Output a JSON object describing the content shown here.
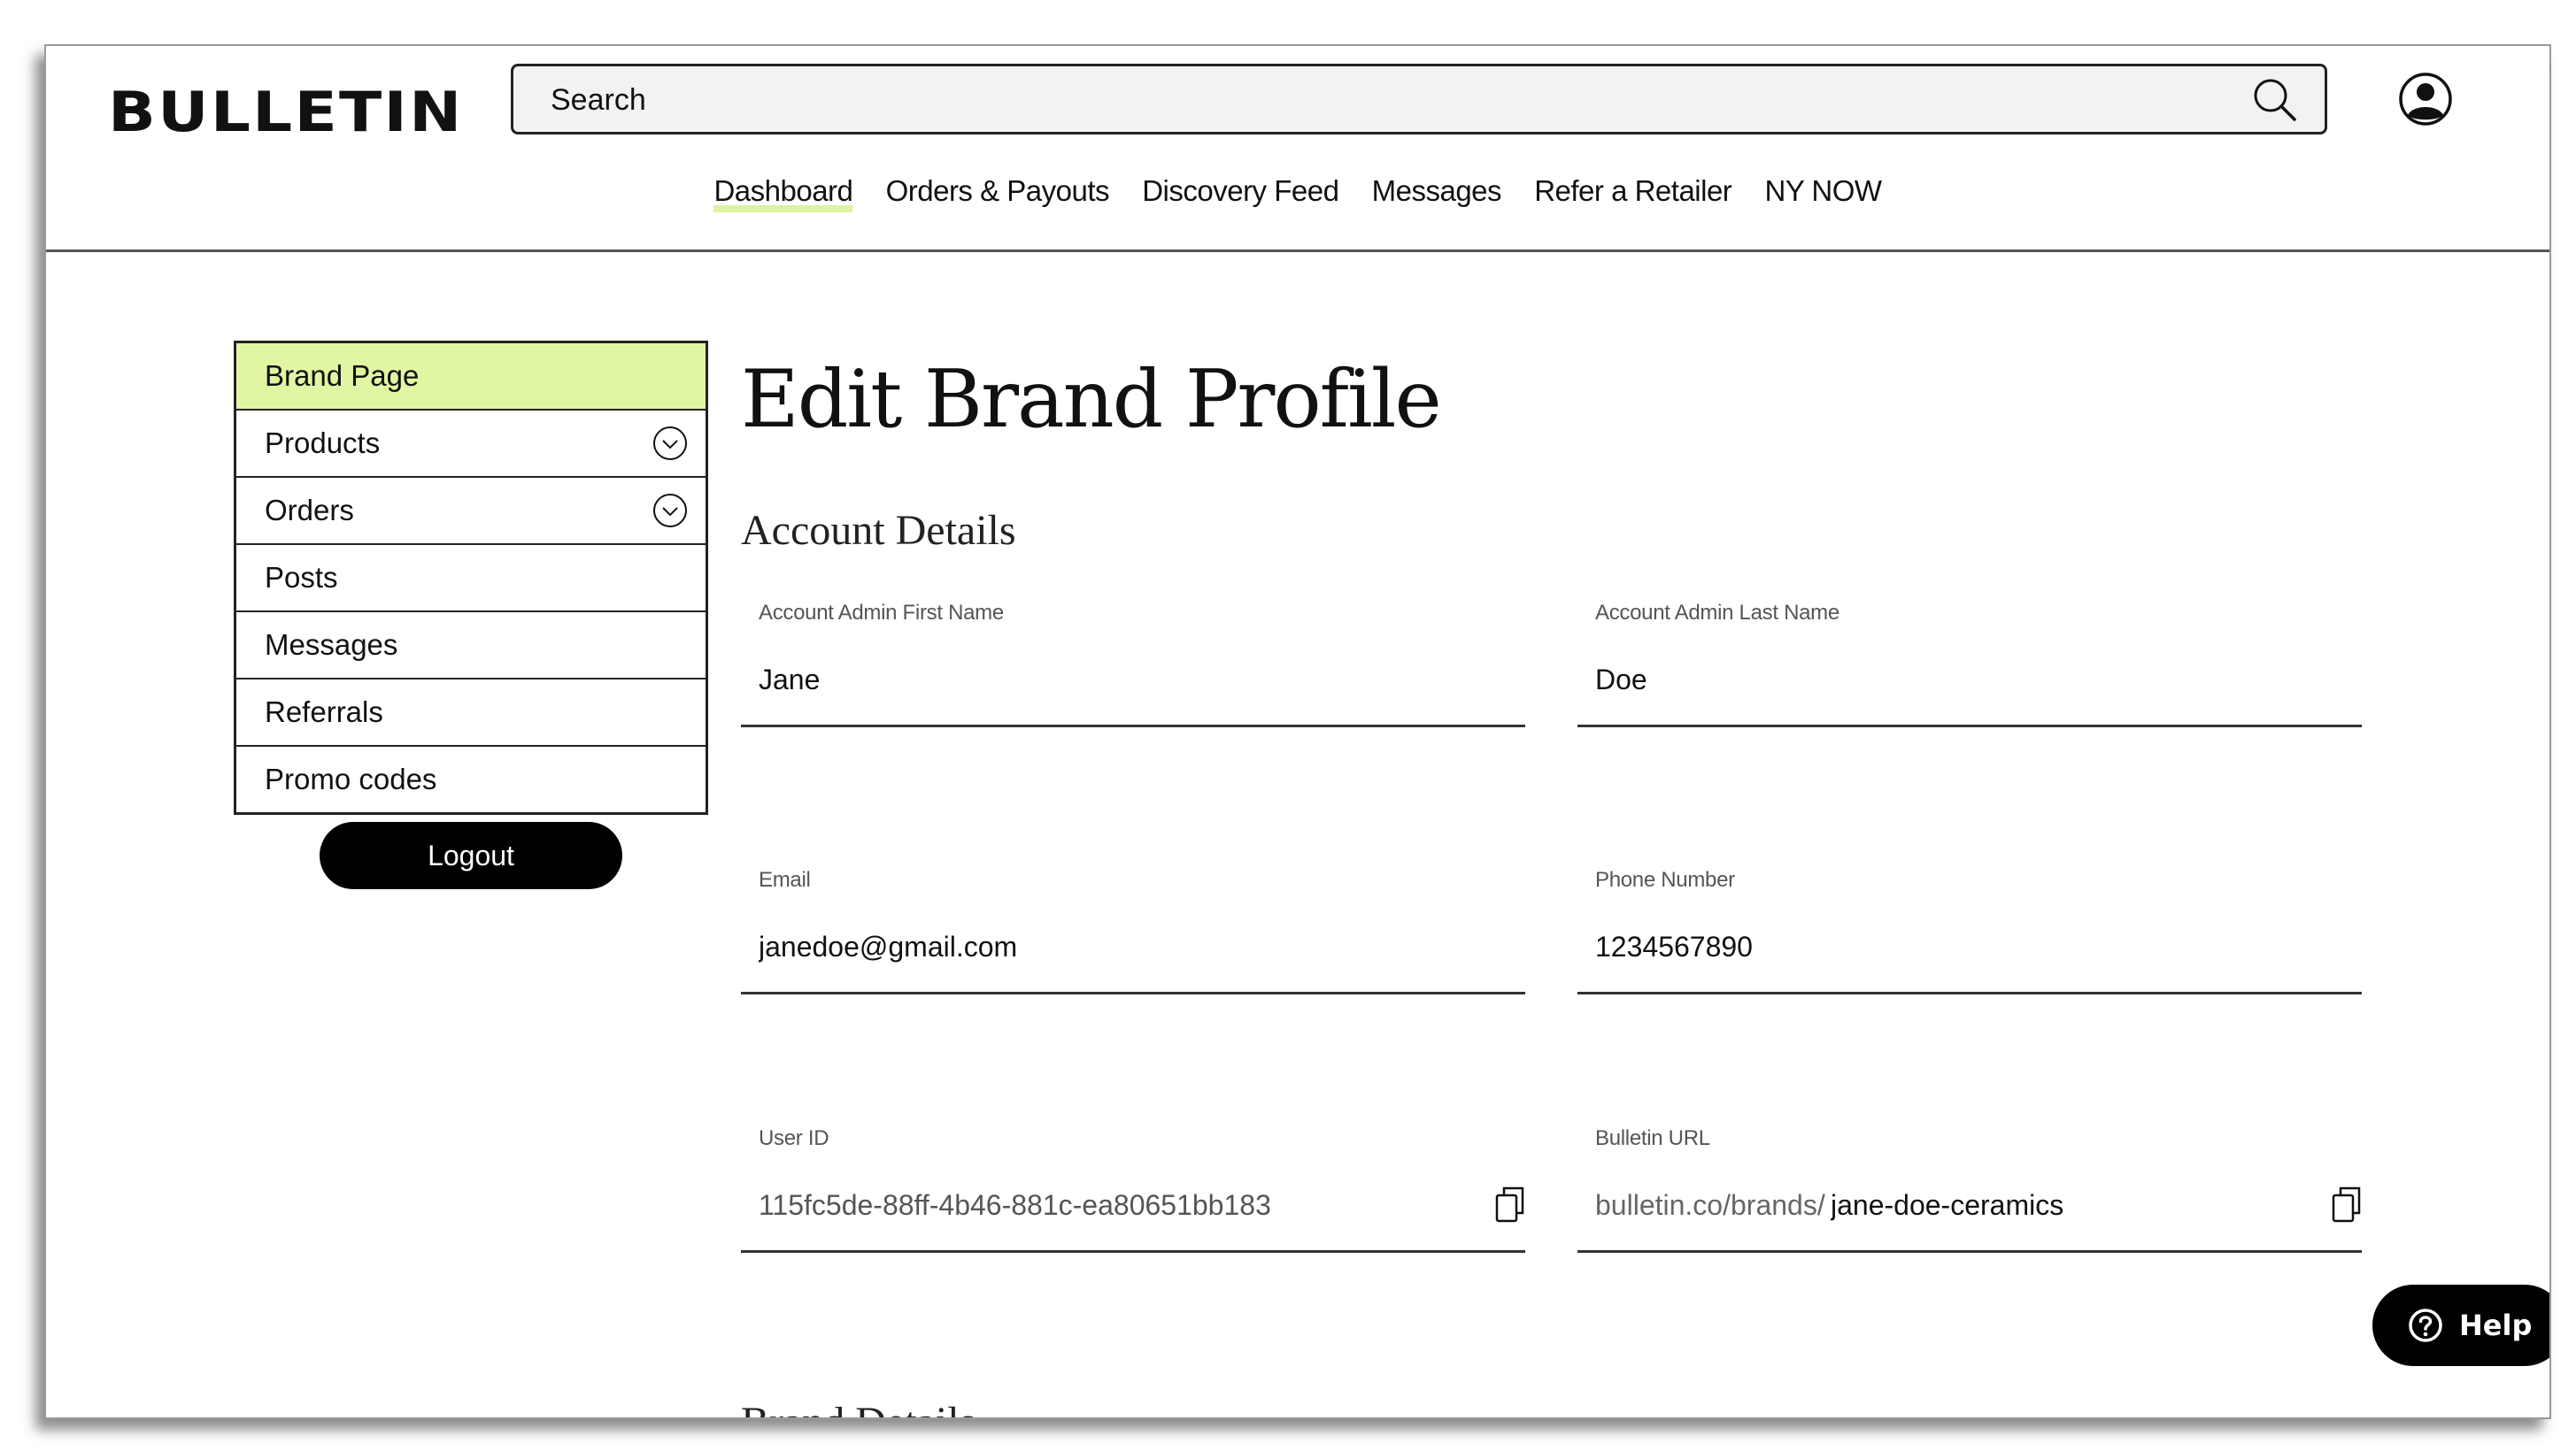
{
  "header": {
    "logo": "BULLETIN",
    "search": {
      "placeholder": "Search",
      "value": ""
    },
    "icons": {
      "search": "search-icon",
      "account": "user-account-icon"
    }
  },
  "nav": {
    "items": [
      {
        "label": "Dashboard",
        "active": true
      },
      {
        "label": "Orders & Payouts"
      },
      {
        "label": "Discovery Feed"
      },
      {
        "label": "Messages"
      },
      {
        "label": "Refer a Retailer"
      },
      {
        "label": "NY NOW"
      }
    ]
  },
  "sidebar": {
    "items": [
      {
        "label": "Brand Page",
        "active": true
      },
      {
        "label": "Products",
        "expandable": true,
        "icon": "chevron-down-circle-icon"
      },
      {
        "label": "Orders",
        "expandable": true,
        "icon": "chevron-down-circle-icon"
      },
      {
        "label": "Posts"
      },
      {
        "label": "Messages"
      },
      {
        "label": "Referrals"
      },
      {
        "label": "Promo codes"
      }
    ],
    "logout": "Logout"
  },
  "main": {
    "title": "Edit Brand Profile",
    "account_section": "Account Details",
    "fields": {
      "first_name": {
        "label": "Account Admin First Name",
        "value": "Jane"
      },
      "last_name": {
        "label": "Account Admin Last Name",
        "value": "Doe"
      },
      "email": {
        "label": "Email",
        "value": "janedoe@gmail.com"
      },
      "phone": {
        "label": "Phone Number",
        "value": "1234567890"
      },
      "user_id": {
        "label": "User ID",
        "value": "115fc5de-88ff-4b46-881c-ea80651bb183",
        "icon": "copy-icon"
      },
      "url": {
        "label": "Bulletin URL",
        "prefix": "bulletin.co/brands/",
        "value": "jane-doe-ceramics",
        "icon": "copy-icon"
      }
    },
    "brand_section": "Brand Details"
  },
  "help": {
    "label": "Help",
    "icon": "help-circle-icon"
  },
  "colors": {
    "accent": "#e1f6a2",
    "nav_underline": "#dcf3a0",
    "button": "#000000",
    "search_bg": "#f2f3f1"
  }
}
